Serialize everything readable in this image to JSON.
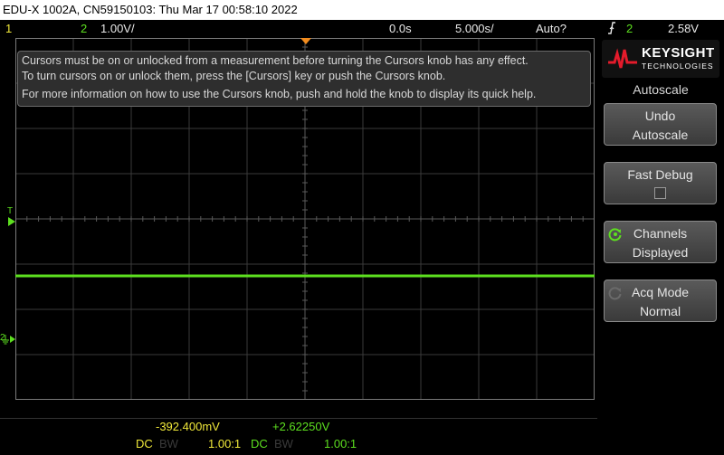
{
  "title_bar": "EDU-X 1002A, CN59150103: Thu Mar 17 00:58:10 2022",
  "status": {
    "ch1_label": "1",
    "ch2_label": "2",
    "ch2_scale": "1.00V/",
    "time_delay": "0.0s",
    "time_scale": "5.000s/",
    "trigger_mode": "Auto?",
    "trigger_icon": "rising-edge-icon",
    "trigger_source": "2",
    "trigger_level": "2.58V"
  },
  "markers": {
    "trigger_level_marker": "T",
    "ch2_ground_marker": "2"
  },
  "message": {
    "line1": "Cursors must be on or unlocked from a measurement before turning the Cursors knob has any effect.",
    "line2": "To turn cursors on or unlock them, press the [Cursors] key or push the Cursors knob.",
    "line3": "For more information on how to use the Cursors knob, push and hold the knob to display its quick help."
  },
  "logo": {
    "brand": "KEYSIGHT",
    "sub": "TECHNOLOGIES"
  },
  "menu": {
    "title": "Autoscale",
    "softkeys": [
      {
        "line1": "Undo",
        "line2": "Autoscale"
      },
      {
        "line1": "Fast Debug",
        "line2": ""
      },
      {
        "line1": "Channels",
        "line2": "Displayed"
      },
      {
        "line1": "Acq Mode",
        "line2": "Normal"
      }
    ]
  },
  "measurements": {
    "ch1_value": "-392.400mV",
    "ch2_value": "+2.62250V",
    "ch1_coupling": "DC",
    "ch1_bw": "BW",
    "ch1_probe": "1.00:1",
    "ch2_coupling": "DC",
    "ch2_bw": "BW",
    "ch2_probe": "1.00:1"
  },
  "colors": {
    "ch1": "#f0e83a",
    "ch2": "#5ddf1f",
    "trigger_marker": "#f28c1e"
  }
}
